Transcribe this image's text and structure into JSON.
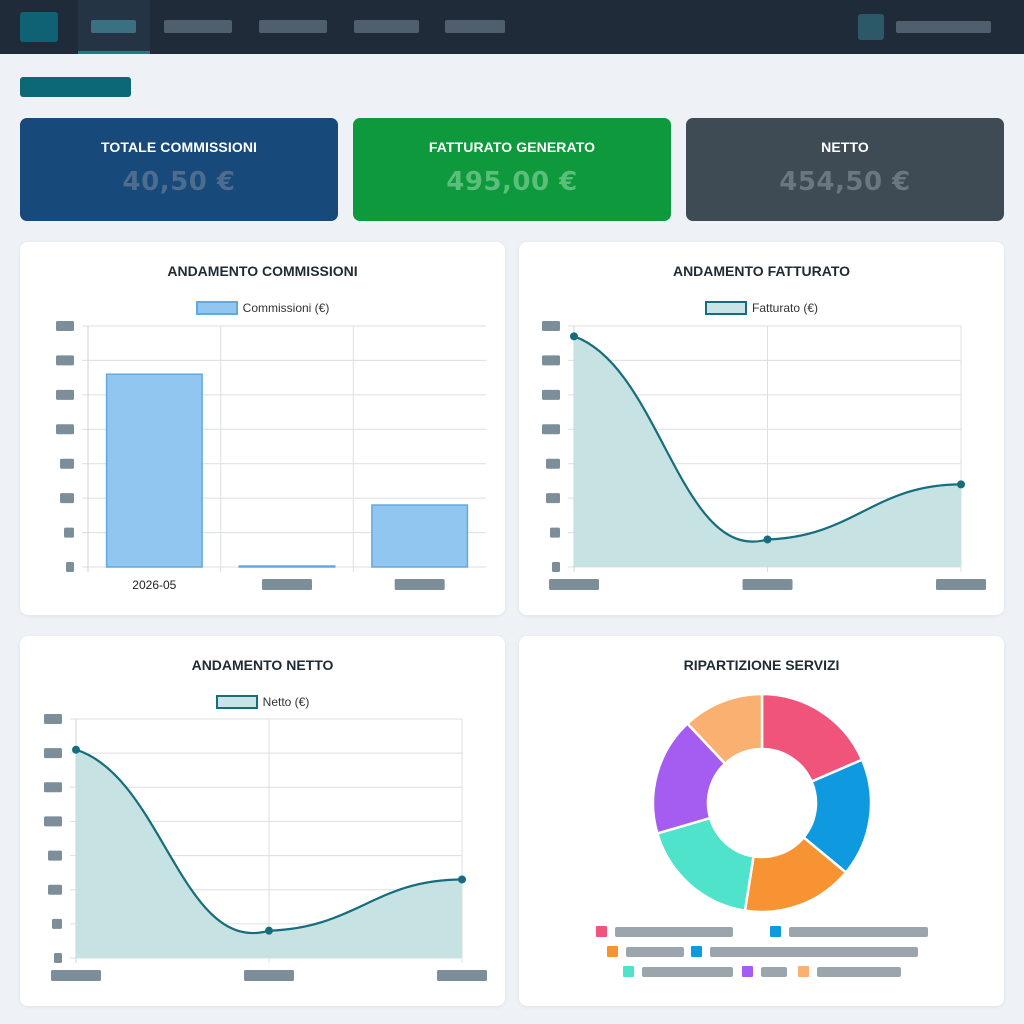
{
  "stats": {
    "commissioni": {
      "label": "TOTALE COMMISSIONI",
      "value": "40,50 €"
    },
    "fatturato": {
      "label": "FATTURATO GENERATO",
      "value": "495,00 €"
    },
    "netto": {
      "label": "NETTO",
      "value": "454,50 €"
    }
  },
  "charts": {
    "commissioni": {
      "title": "ANDAMENTO COMMISSIONI",
      "legend": "Commissioni (€)"
    },
    "fatturato": {
      "title": "ANDAMENTO FATTURATO",
      "legend": "Fatturato (€)"
    },
    "netto": {
      "title": "ANDAMENTO NETTO",
      "legend": "Netto (€)"
    },
    "servizi": {
      "title": "RIPARTIZIONE SERVIZI"
    }
  },
  "chart_data": [
    {
      "type": "bar",
      "title": "ANDAMENTO COMMISSIONI",
      "categories": [
        "2026-05",
        "",
        ""
      ],
      "series": [
        {
          "name": "Commissioni (€)",
          "values": [
            28,
            0.1,
            9
          ]
        }
      ],
      "ylim": [
        0,
        35
      ],
      "grid": true,
      "legend": "top",
      "color": "#90c6f0"
    },
    {
      "type": "area",
      "title": "ANDAMENTO FATTURATO",
      "categories": [
        "",
        "",
        ""
      ],
      "series": [
        {
          "name": "Fatturato (€)",
          "values": [
            335,
            40,
            120
          ]
        }
      ],
      "ylim": [
        0,
        350
      ],
      "grid": true,
      "legend": "top",
      "color": "#166d7d"
    },
    {
      "type": "area",
      "title": "ANDAMENTO NETTO",
      "categories": [
        "",
        "",
        ""
      ],
      "series": [
        {
          "name": "Netto (€)",
          "values": [
            305,
            40,
            115
          ]
        }
      ],
      "ylim": [
        0,
        350
      ],
      "grid": true,
      "legend": "top",
      "color": "#166d7d"
    },
    {
      "type": "pie",
      "title": "RIPARTIZIONE SERVIZI",
      "labels": [
        "",
        "",
        "",
        "",
        "",
        "",
        ""
      ],
      "values": [
        18.5,
        17.5,
        16.5,
        18,
        17.5,
        12
      ],
      "colors": [
        "#f0547a",
        "#0f9ae0",
        "#f79333",
        "#50e3cc",
        "#a55cf0",
        "#f9b070"
      ],
      "legend": "bottom"
    }
  ]
}
